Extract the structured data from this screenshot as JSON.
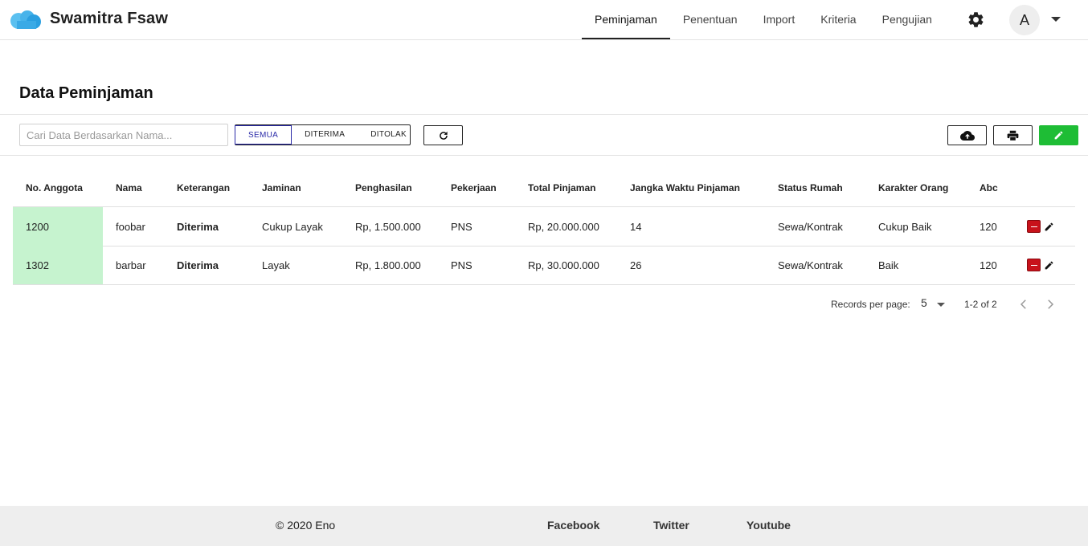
{
  "header": {
    "brand": "Swamitra Fsaw",
    "nav": [
      {
        "label": "Peminjaman",
        "active": true
      },
      {
        "label": "Penentuan",
        "active": false
      },
      {
        "label": "Import",
        "active": false
      },
      {
        "label": "Kriteria",
        "active": false
      },
      {
        "label": "Pengujian",
        "active": false
      }
    ],
    "avatar_initial": "A",
    "icons": {
      "settings": "gear-icon",
      "menu": "chevron-down-icon",
      "logo": "cloud-logo"
    }
  },
  "page": {
    "title": "Data Peminjaman"
  },
  "toolbar": {
    "search_placeholder": "Cari Data Berdasarkan Nama...",
    "search_value": "",
    "filters": [
      {
        "label": "SEMUA",
        "active": true
      },
      {
        "label": "DITERIMA",
        "active": false
      },
      {
        "label": "DITOLAK",
        "active": false
      }
    ],
    "icons": {
      "refresh": "refresh-icon",
      "upload": "cloud-upload-icon",
      "print": "print-icon",
      "edit": "pencil-icon"
    }
  },
  "table": {
    "columns": [
      "No. Anggota",
      "Nama",
      "Keterangan",
      "Jaminan",
      "Penghasilan",
      "Pekerjaan",
      "Total Pinjaman",
      "Jangka Waktu Pinjaman",
      "Status Rumah",
      "Karakter Orang",
      "Abc"
    ],
    "rows": [
      [
        "1200",
        "foobar",
        "Diterima",
        "Cukup Layak",
        "Rp, 1.500.000",
        "PNS",
        "Rp, 20.000.000",
        "14",
        "Sewa/Kontrak",
        "Cukup Baik",
        "120"
      ],
      [
        "1302",
        "barbar",
        "Diterima",
        "Layak",
        "Rp, 1.800.000",
        "PNS",
        "Rp, 30.000.000",
        "26",
        "Sewa/Kontrak",
        "Baik",
        "120"
      ]
    ]
  },
  "pagination": {
    "label": "Records per page:",
    "per_page": "5",
    "range": "1-2 of 2"
  },
  "footer": {
    "copyright": "© 2020  Eno",
    "links": [
      "Facebook",
      "Twitter",
      "Youtube"
    ]
  },
  "colors": {
    "accent_green": "#1ebd35",
    "id_cell_bg": "#c6f3cf",
    "delete_red": "#c8121b",
    "active_filter": "#2a2aa8"
  }
}
